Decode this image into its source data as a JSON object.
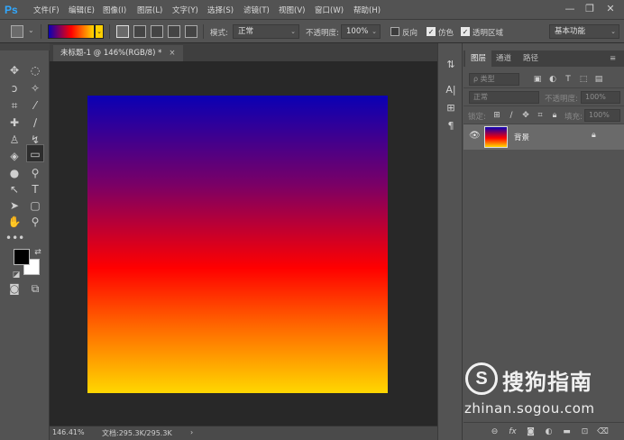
{
  "app": {
    "logo": "Ps"
  },
  "menu": [
    "文件(F)",
    "编辑(E)",
    "图像(I)",
    "图层(L)",
    "文字(Y)",
    "选择(S)",
    "滤镜(T)",
    "视图(V)",
    "窗口(W)",
    "帮助(H)"
  ],
  "window_controls": {
    "minimize": "—",
    "restore": "❐",
    "close": "✕"
  },
  "options": {
    "gradient_colors": [
      "#0a00b4",
      "#ff0000",
      "#ffd700"
    ],
    "mode_label": "模式:",
    "mode_value": "正常",
    "opacity_label": "不透明度:",
    "opacity_value": "100%",
    "reverse_label": "反向",
    "reverse_checked": false,
    "dither_label": "仿色",
    "dither_checked": true,
    "transparency_label": "透明区域",
    "transparency_checked": true,
    "workspace": "基本功能"
  },
  "document": {
    "tab_title": "未标题-1 @ 146%(RGB/8) *",
    "close": "×",
    "canvas_gradient": [
      "#0a00b4",
      "#ff0000",
      "#ffd700"
    ],
    "zoom": "146.41%",
    "doc_info": "文档:295.3K/295.3K",
    "status_arrow": "›"
  },
  "panels": {
    "tabs": [
      "图层",
      "通道",
      "路径"
    ],
    "active_tab": "图层",
    "filter_placeholder": "ρ 类型",
    "blend_mode": "正常",
    "opacity_label": "不透明度:",
    "opacity_value": "100%",
    "lock_label": "锁定:",
    "fill_label": "填充:",
    "fill_value": "100%",
    "layers": [
      {
        "name": "背景",
        "visible": true,
        "locked": true
      }
    ]
  },
  "watermark": {
    "logo_letter": "S",
    "title": "搜狗指南",
    "url": "zhinan.sogou.com"
  }
}
